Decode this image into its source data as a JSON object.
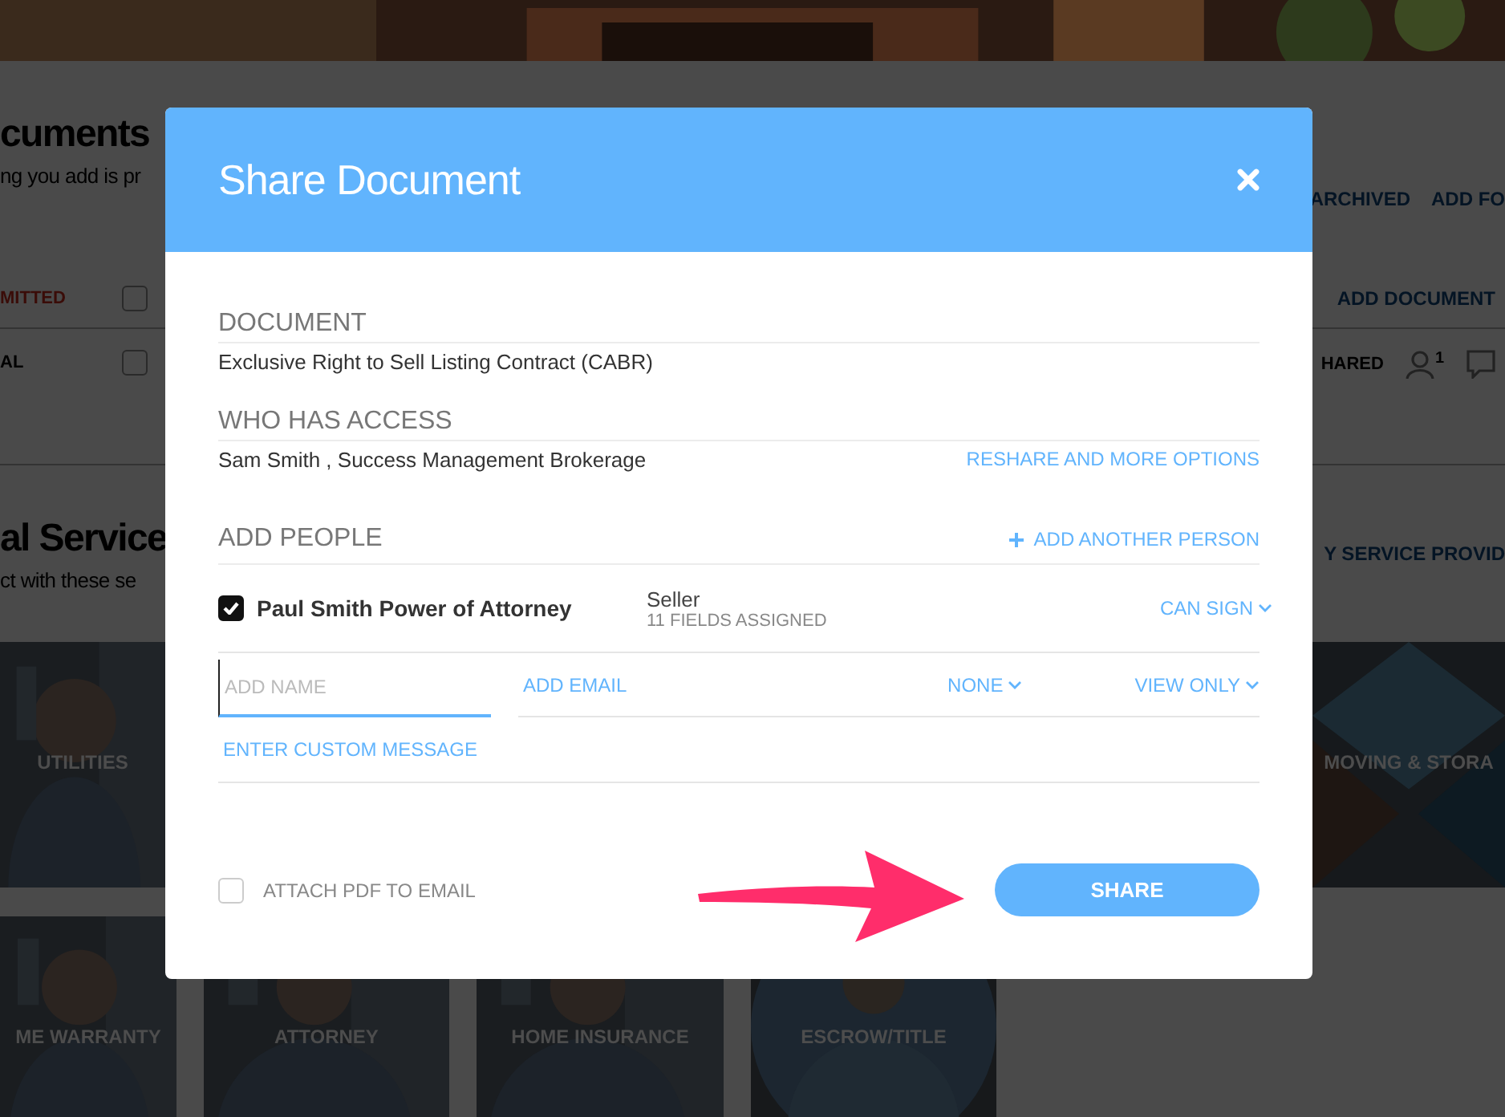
{
  "background_page": {
    "heading": "cuments",
    "subtitle": "ng you add is pr",
    "top_links": [
      "ARCHIVED",
      "ADD FO"
    ],
    "rows": [
      {
        "status": "MITTED",
        "color": "#3a0c08",
        "checked": false,
        "action": "ADD DOCUMENT"
      },
      {
        "status": "AL",
        "color": "#000000",
        "checked": false,
        "shared": "HARED",
        "count": "1"
      }
    ],
    "services_heading": "al Service",
    "services_subtitle": "ct with these se",
    "services_link": "Y SERVICE PROVID",
    "tiles": [
      {
        "label": "UTILITIES"
      },
      {
        "label": "MOVING & STORA"
      }
    ],
    "tiles_2": [
      {
        "label": "ME WARRANTY"
      },
      {
        "label": "ATTORNEY"
      },
      {
        "label": "HOME INSURANCE"
      },
      {
        "label": "ESCROW/TITLE"
      }
    ]
  },
  "dialog": {
    "title": "Share Document",
    "sections": [
      {
        "label": "DOCUMENT",
        "value": "Exclusive Right to Sell Listing Contract (CABR)"
      },
      {
        "label": "WHO HAS ACCESS",
        "value": "Sam Smith , Success Management Brokerage",
        "link": "RESHARE AND MORE OPTIONS"
      }
    ],
    "add_people": {
      "label": "ADD PEOPLE",
      "add_link": "ADD ANOTHER PERSON",
      "people": [
        {
          "name": "Paul Smith Power of Attorney",
          "checked": true,
          "role": "Seller",
          "fields": "11 FIELDS ASSIGNED",
          "permission": "CAN SIGN"
        }
      ],
      "new_person": {
        "name_placeholder": "ADD NAME",
        "email_placeholder": "ADD EMAIL",
        "role": "NONE",
        "permission": "VIEW ONLY",
        "focused": true
      },
      "message_link": "ENTER CUSTOM MESSAGE"
    },
    "attach_pdf": {
      "label": "ATTACH PDF TO EMAIL",
      "checked": false
    },
    "share_button": "SHARE"
  }
}
